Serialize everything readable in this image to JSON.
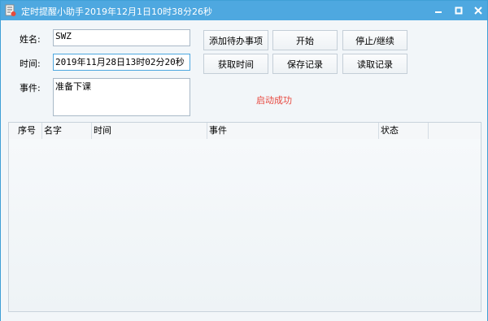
{
  "window": {
    "title": "定时提醒小助手",
    "current_time": "2019年12月1日10时38分26秒",
    "accent_color": "#4ea8e0",
    "controls": [
      "minimize-icon",
      "maximize-icon",
      "close-icon"
    ]
  },
  "form": {
    "name_label": "姓名:",
    "name_value": "SWZ",
    "time_label": "时间:",
    "time_value": "2019年11月28日13时02分20秒",
    "event_label": "事件:",
    "event_value": "准备下课"
  },
  "buttons": {
    "add_todo": "添加待办事项",
    "start": "开始",
    "stop_continue": "停止/继续",
    "get_time": "获取时间",
    "save_record": "保存记录",
    "read_record": "读取记录"
  },
  "status": {
    "message": "启动成功",
    "color": "#e8483f"
  },
  "table": {
    "columns": [
      "序号",
      "名字",
      "时间",
      "事件",
      "状态"
    ],
    "rows": []
  }
}
